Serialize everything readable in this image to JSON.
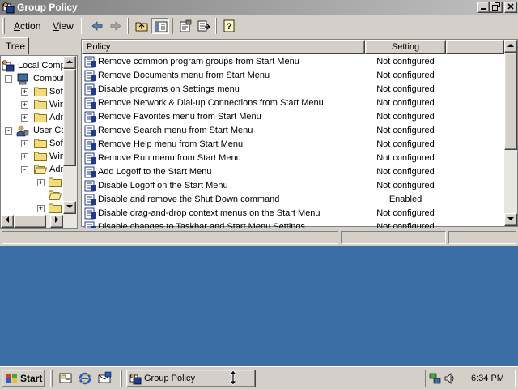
{
  "window": {
    "title": "Group Policy"
  },
  "menus": [
    {
      "label": "Action",
      "ul": "A",
      "rest": "ction"
    },
    {
      "label": "View",
      "ul": "V",
      "rest": "iew"
    }
  ],
  "tree": {
    "tab_label": "Tree",
    "nodes": [
      {
        "label": "Local Compu",
        "expander": "",
        "icon": "local-computer-policy-icon"
      },
      {
        "label": "Comput",
        "expander": "-",
        "icon": "computer-configuration-icon"
      },
      {
        "label": "Soft",
        "expander": "+",
        "icon": "folder-icon"
      },
      {
        "label": "Win",
        "expander": "+",
        "icon": "folder-icon"
      },
      {
        "label": "Adm",
        "expander": "+",
        "icon": "folder-icon"
      },
      {
        "label": "User Co",
        "expander": "-",
        "icon": "user-configuration-icon"
      },
      {
        "label": "Soft",
        "expander": "+",
        "icon": "folder-icon"
      },
      {
        "label": "Win",
        "expander": "+",
        "icon": "folder-icon"
      },
      {
        "label": "Adm",
        "expander": "-",
        "icon": "folder-open-icon"
      },
      {
        "label": "",
        "expander": "+",
        "icon": "folder-icon"
      },
      {
        "label": "",
        "expander": "",
        "icon": "folder-open-icon"
      },
      {
        "label": "",
        "expander": "+",
        "icon": "folder-icon"
      }
    ]
  },
  "list": {
    "columns": [
      "Policy",
      "Setting"
    ],
    "rows": [
      {
        "policy": "Remove common program groups from Start Menu",
        "setting": "Not configured"
      },
      {
        "policy": "Remove Documents menu from Start Menu",
        "setting": "Not configured"
      },
      {
        "policy": "Disable programs on Settings menu",
        "setting": "Not configured"
      },
      {
        "policy": "Remove Network & Dial-up Connections from Start Menu",
        "setting": "Not configured"
      },
      {
        "policy": "Remove Favorites menu from Start Menu",
        "setting": "Not configured"
      },
      {
        "policy": "Remove Search menu from Start Menu",
        "setting": "Not configured"
      },
      {
        "policy": "Remove Help menu from Start Menu",
        "setting": "Not configured"
      },
      {
        "policy": "Remove Run menu from Start Menu",
        "setting": "Not configured"
      },
      {
        "policy": "Add Logoff to the Start Menu",
        "setting": "Not configured"
      },
      {
        "policy": "Disable Logoff on the Start Menu",
        "setting": "Not configured"
      },
      {
        "policy": "Disable and remove the Shut Down command",
        "setting": "Enabled"
      },
      {
        "policy": "Disable drag-and-drop context menus on the Start Menu",
        "setting": "Not configured"
      },
      {
        "policy": "Disable changes to Taskbar and Start Menu Settings",
        "setting": "Not configured"
      }
    ]
  },
  "taskbar": {
    "start_label": "Start",
    "task_label": "Group Policy",
    "clock": "6:34 PM",
    "quick_launch": [
      "show-desktop-icon",
      "internet-explorer-icon",
      "outlook-express-icon"
    ]
  },
  "colors": {
    "desktop": "#3a6ea5",
    "face": "#d4d0c8",
    "title_inactive_start": "#808080",
    "title_inactive_end": "#c0c0c0"
  }
}
